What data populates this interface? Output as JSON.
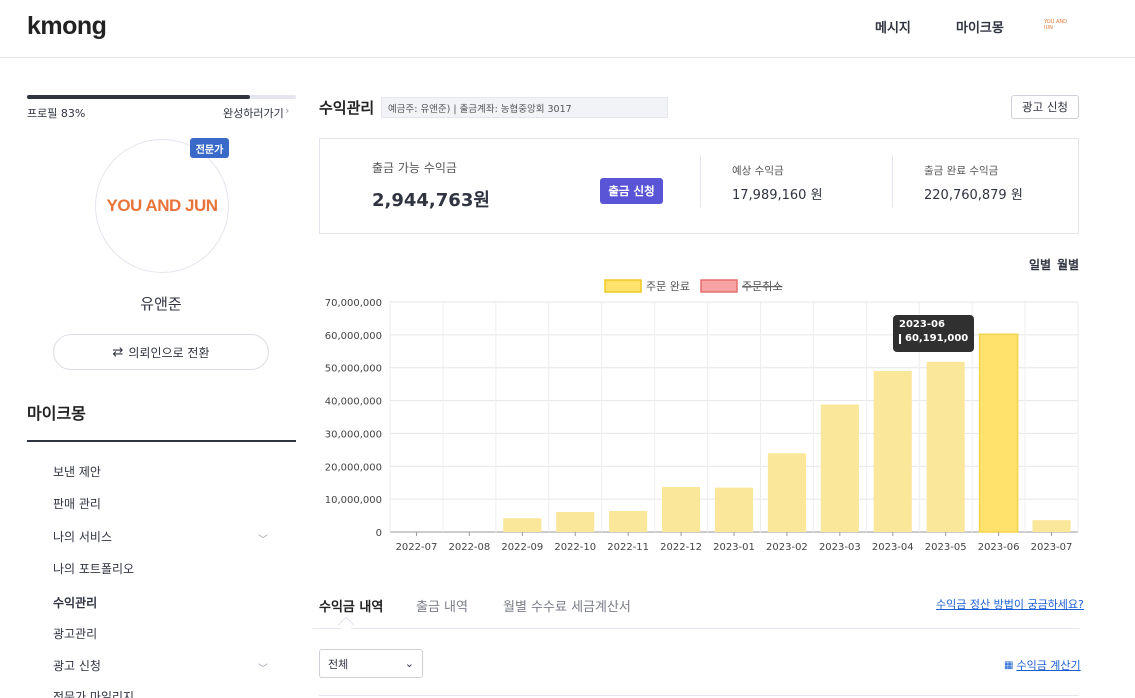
{
  "header": {
    "logo": "kmong",
    "nav": [
      "메시지",
      "마이크몽"
    ],
    "avatar_text": "YOU AND JUN"
  },
  "sidebar": {
    "profile_label": "프로필 83%",
    "profile_progress_pct": 83,
    "complete_label": "완성하러가기",
    "badge": "전문가",
    "avatar_logo": "YOU AND JUN",
    "username": "유앤준",
    "switch_button": "의뢰인으로 전환",
    "section_title": "마이크몽",
    "items": [
      {
        "label": "보낸 제안",
        "expandable": false
      },
      {
        "label": "판매 관리",
        "expandable": false
      },
      {
        "label": "나의 서비스",
        "expandable": true
      },
      {
        "label": "나의 포트폴리오",
        "expandable": false
      },
      {
        "label": "수익관리",
        "expandable": false,
        "active": true
      },
      {
        "label": "광고관리",
        "expandable": false
      },
      {
        "label": "광고 신청",
        "expandable": true
      },
      {
        "label": "전문가 마일리지",
        "expandable": false
      }
    ]
  },
  "main": {
    "title": "수익관리",
    "account_info": "예금주:          유앤준)  |  출금계좌: 농협중앙회 3017",
    "ad_button": "광고 신청",
    "summary": {
      "available_label": "출금 가능 수익금",
      "available_value": "2,944,763원",
      "withdraw_button": "출금 신청",
      "expected_label": "예상 수익금",
      "expected_value": "17,989,160 원",
      "completed_label": "출금 완료 수익금",
      "completed_value": "220,760,879 원"
    },
    "period_options": [
      "일별",
      "월별"
    ],
    "tooltip": {
      "label": "2023-06",
      "value": "60,191,000"
    },
    "tabs": [
      "수익금 내역",
      "출금 내역",
      "월별 수수료 세금계산서"
    ],
    "help_link": "수익금 정산 방법이 궁금하세요?",
    "filter_select": "전체",
    "calc_link": "수익금 계산기"
  },
  "colors": {
    "bar": "#fbe79a",
    "bar_highlight": "#ffe26b",
    "legend_cancel": "#f7a3a3",
    "withdraw_button": "#5a55d6",
    "badge": "#3a6ac9",
    "link": "#1c5fd1"
  },
  "chart_data": {
    "type": "bar",
    "categories": [
      "2022-07",
      "2022-08",
      "2022-09",
      "2022-10",
      "2022-11",
      "2022-12",
      "2023-01",
      "2023-02",
      "2023-03",
      "2023-04",
      "2023-05",
      "2023-06",
      "2023-07"
    ],
    "series": [
      {
        "name": "주문 완료",
        "values": [
          0,
          0,
          4200000,
          6100000,
          6400000,
          13700000,
          13500000,
          24000000,
          38800000,
          49000000,
          51800000,
          60191000,
          3600000
        ]
      },
      {
        "name": "주문취소",
        "values": [
          0,
          0,
          0,
          0,
          0,
          0,
          0,
          0,
          0,
          0,
          0,
          0,
          0
        ]
      }
    ],
    "ylim": [
      0,
      70000000
    ],
    "yticks": [
      "0",
      "10,000,000",
      "20,000,000",
      "30,000,000",
      "40,000,000",
      "50,000,000",
      "60,000,000",
      "70,000,000"
    ],
    "ytick_values": [
      0,
      10000000,
      20000000,
      30000000,
      40000000,
      50000000,
      60000000,
      70000000
    ],
    "highlight": "2023-06",
    "grid": true,
    "legend_position": "top",
    "xlabel": "",
    "ylabel": ""
  }
}
